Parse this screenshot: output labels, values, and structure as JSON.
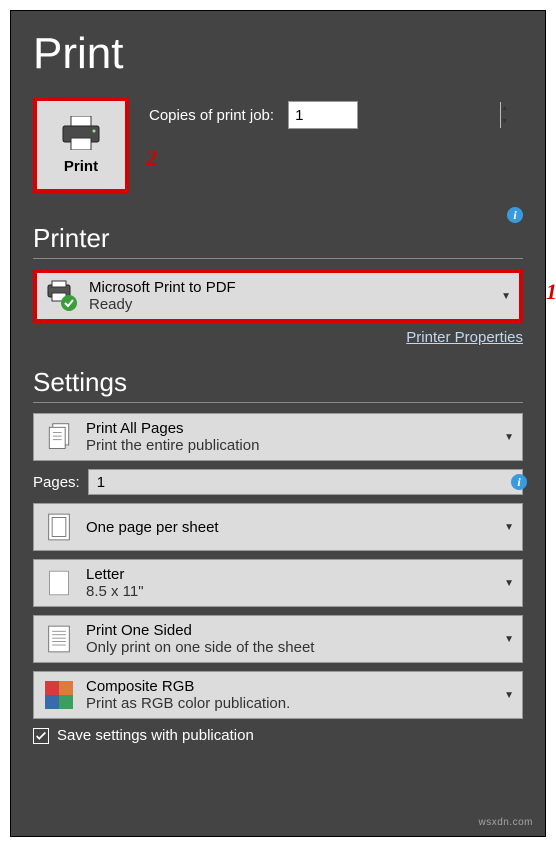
{
  "page": {
    "title": "Print"
  },
  "print_button": {
    "label": "Print",
    "callout": "2"
  },
  "copies": {
    "label": "Copies of print job:",
    "value": "1"
  },
  "printer_section": {
    "header": "Printer",
    "selected": {
      "name": "Microsoft Print to PDF",
      "status": "Ready"
    },
    "callout": "1",
    "properties_link": "Printer Properties"
  },
  "settings_section": {
    "header": "Settings",
    "print_range": {
      "title": "Print All Pages",
      "sub": "Print the entire publication"
    },
    "pages": {
      "label": "Pages:",
      "value": "1"
    },
    "layout": {
      "title": "One page per sheet"
    },
    "paper": {
      "title": "Letter",
      "sub": "8.5 x 11\""
    },
    "sides": {
      "title": "Print One Sided",
      "sub": "Only print on one side of the sheet"
    },
    "color": {
      "title": "Composite RGB",
      "sub": "Print as RGB color publication."
    },
    "save_settings": {
      "label": "Save settings with publication",
      "checked": true
    }
  },
  "watermark": "wsxdn.com"
}
